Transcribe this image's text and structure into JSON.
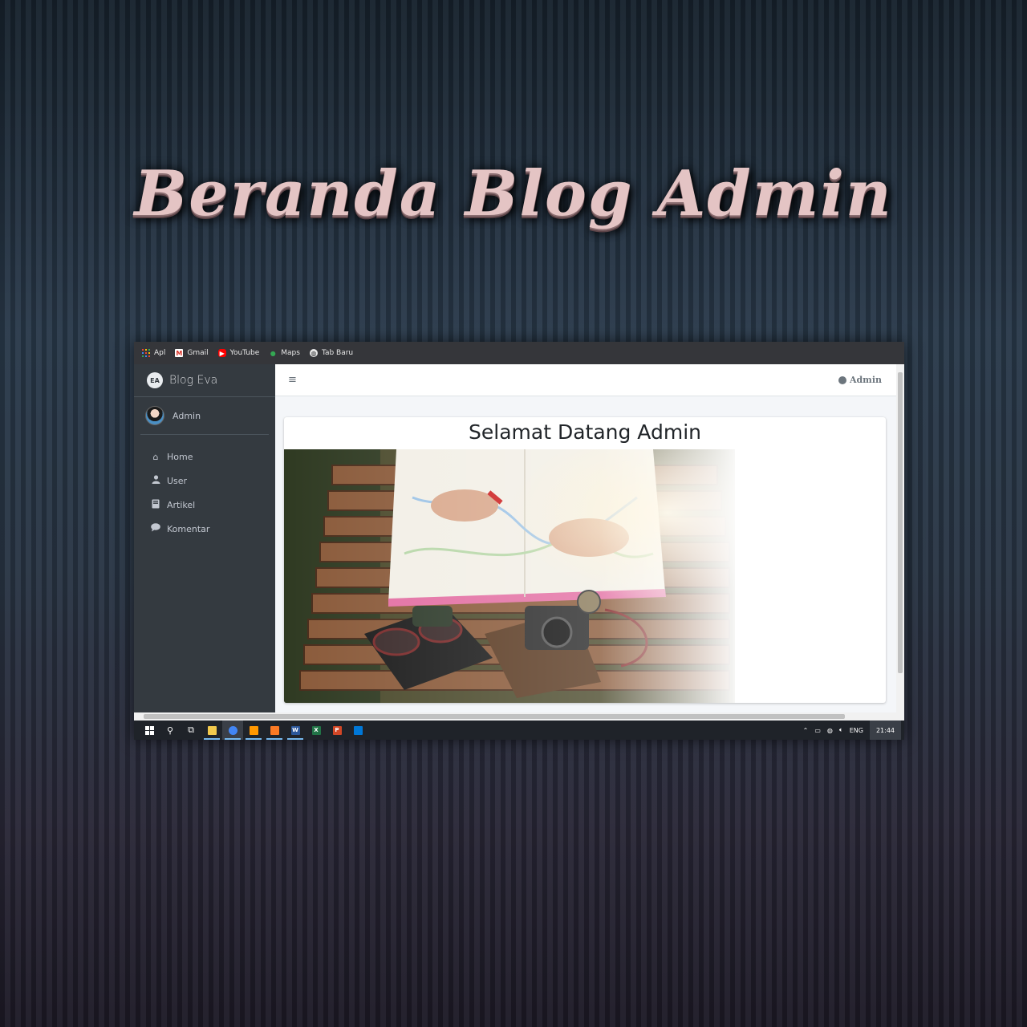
{
  "poster": {
    "title": "Beranda Blog Admin"
  },
  "browser": {
    "bookmarks": [
      {
        "label": "Apl",
        "icon": "apps-grid-icon"
      },
      {
        "label": "Gmail",
        "icon": "gmail-icon"
      },
      {
        "label": "YouTube",
        "icon": "youtube-icon"
      },
      {
        "label": "Maps",
        "icon": "maps-pin-icon"
      },
      {
        "label": "Tab Baru",
        "icon": "globe-icon"
      }
    ]
  },
  "sidebar": {
    "brand_logo": "EA",
    "brand": "Blog Eva",
    "user_name": "Admin",
    "items": [
      {
        "label": "Home",
        "icon": "home-icon"
      },
      {
        "label": "User",
        "icon": "user-icon"
      },
      {
        "label": "Artikel",
        "icon": "book-icon"
      },
      {
        "label": "Komentar",
        "icon": "comment-icon"
      }
    ]
  },
  "header": {
    "menu_icon": "≡",
    "user_label": "Admin"
  },
  "content": {
    "heading": "Selamat Datang Admin"
  },
  "taskbar": {
    "language": "ENG",
    "time": "21:44"
  },
  "colors": {
    "sidebar": "#343a40",
    "content_bg": "#f4f6f9",
    "taskbar": "#1f2329",
    "bookmark_bar": "#35363a"
  }
}
